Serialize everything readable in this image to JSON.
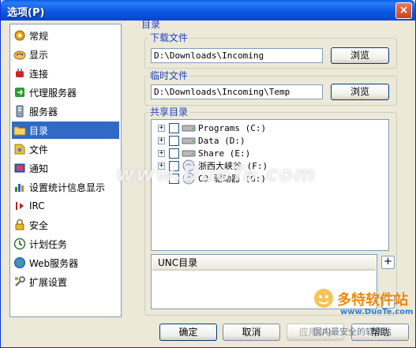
{
  "window": {
    "title": "选项(P)",
    "close_glyph": "×"
  },
  "sidebar": {
    "items": [
      {
        "label": "常规",
        "icon": "gear-icon",
        "selected": false
      },
      {
        "label": "显示",
        "icon": "display-icon",
        "selected": false
      },
      {
        "label": "连接",
        "icon": "plug-icon",
        "selected": false
      },
      {
        "label": "代理服务器",
        "icon": "proxy-icon",
        "selected": false
      },
      {
        "label": "服务器",
        "icon": "server-icon",
        "selected": false
      },
      {
        "label": "目录",
        "icon": "folder-icon",
        "selected": true
      },
      {
        "label": "文件",
        "icon": "file-icon",
        "selected": false
      },
      {
        "label": "通知",
        "icon": "notify-icon",
        "selected": false
      },
      {
        "label": "设置统计信息显示",
        "icon": "stats-icon",
        "selected": false
      },
      {
        "label": "IRC",
        "icon": "irc-icon",
        "selected": false
      },
      {
        "label": "安全",
        "icon": "lock-icon",
        "selected": false
      },
      {
        "label": "计划任务",
        "icon": "clock-icon",
        "selected": false
      },
      {
        "label": "Web服务器",
        "icon": "globe-icon",
        "selected": false
      },
      {
        "label": "扩展设置",
        "icon": "wrench-icon",
        "selected": false
      }
    ]
  },
  "panel": {
    "title": "目录",
    "download": {
      "label": "下载文件",
      "value": "D:\\Downloads\\Incoming",
      "browse": "浏览"
    },
    "temp": {
      "label": "临时文件",
      "value": "D:\\Downloads\\Incoming\\Temp",
      "browse": "浏览"
    },
    "shared": {
      "label": "共享目录",
      "drives": [
        {
          "label": "Programs (C:)",
          "icon": "hard-drive-icon"
        },
        {
          "label": "Data (D:)",
          "icon": "hard-drive-icon"
        },
        {
          "label": "Share (E:)",
          "icon": "hard-drive-icon"
        },
        {
          "label": "浙西大峡谷 (F:)",
          "icon": "cd-drive-icon"
        },
        {
          "label": "CD 驱动器 (G:)",
          "icon": "cd-drive-icon"
        }
      ],
      "expander_glyph": "+"
    },
    "unc": {
      "header": "UNC目录",
      "add_glyph": "+",
      "remove_glyph": "−"
    }
  },
  "buttons": {
    "ok": "确定",
    "cancel": "取消",
    "apply": "应用(A)",
    "help": "帮助"
  },
  "watermark": {
    "text": "www.DuoTe.com"
  },
  "logo": {
    "name": "多特软件站",
    "url": "www.DuoTe.com",
    "slogan": "国内最安全的软件站"
  },
  "colors": {
    "selection": "#316ac5",
    "group_label": "#1f3fbf",
    "titlebar": "#0b58e0"
  }
}
